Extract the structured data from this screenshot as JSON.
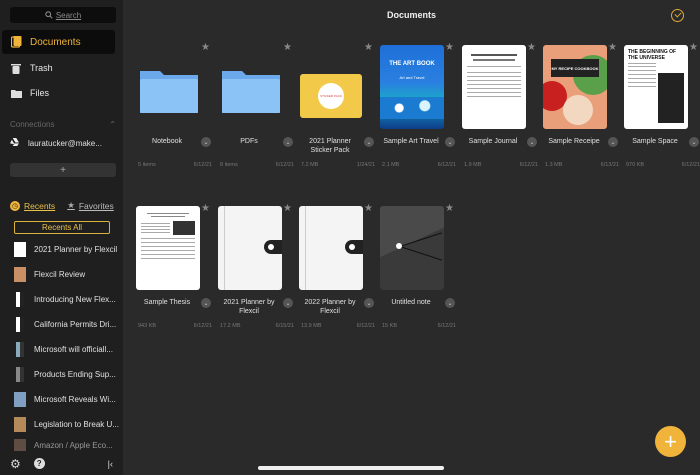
{
  "sidebar": {
    "search_placeholder": "Search",
    "nav": [
      {
        "label": "Documents",
        "icon": "documents-icon"
      },
      {
        "label": "Trash",
        "icon": "trash-icon"
      },
      {
        "label": "Files",
        "icon": "folder-icon"
      }
    ],
    "connections_label": "Connections",
    "account": "lauratucker@make...",
    "add_label": "+",
    "tabs": {
      "recents": "Recents",
      "favorites": "Favorites"
    },
    "recents_all": "Recents All",
    "recents": [
      {
        "title": "2021 Planner by Flexcil"
      },
      {
        "title": "Flexcil Review"
      },
      {
        "title": "Introducing New Flex..."
      },
      {
        "title": "California Permits Dri..."
      },
      {
        "title": "Microsoft will officiall..."
      },
      {
        "title": "Products Ending Sup..."
      },
      {
        "title": "Microsoft Reveals Wi..."
      },
      {
        "title": "Legislation to Break U..."
      },
      {
        "title": "Amazon / Apple Eco..."
      }
    ]
  },
  "header": {
    "title": "Documents"
  },
  "items": [
    {
      "name": "Notebook",
      "size": "5 items",
      "date": "6/12/21",
      "kind": "folder"
    },
    {
      "name": "PDFs",
      "size": "8 items",
      "date": "6/12/21",
      "kind": "folder"
    },
    {
      "name": "2021 Planner Sticker Pack",
      "size": "7.2 MB",
      "date": "1/24/21",
      "kind": "sticker",
      "inner_text": "STICKER PACK"
    },
    {
      "name": "Sample Art Travel",
      "size": "2.1 MB",
      "date": "6/12/21",
      "kind": "art",
      "inner_title": "THE ART BOOK",
      "inner_sub": "Art and Travel"
    },
    {
      "name": "Sample Journal",
      "size": "1.9 MB",
      "date": "6/12/21",
      "kind": "journal"
    },
    {
      "name": "Sample Receipe",
      "size": "1.3 MB",
      "date": "6/13/21",
      "kind": "recipe",
      "inner_title": "MY RECIPE COOKBOOK"
    },
    {
      "name": "Sample Space",
      "size": "970 KB",
      "date": "6/12/21",
      "kind": "space",
      "inner_title": "THE BEGINNING OF THE UNIVERSE"
    },
    {
      "name": "Sample Thesis",
      "size": "943 KB",
      "date": "6/12/21",
      "kind": "thesis"
    },
    {
      "name": "2021 Planner by Flexcil",
      "size": "17.2 MB",
      "date": "6/15/21",
      "kind": "planner-white"
    },
    {
      "name": "2022 Planner by Flexcil",
      "size": "13.9 MB",
      "date": "6/12/21",
      "kind": "planner-white"
    },
    {
      "name": "Untitled note",
      "size": "15 KB",
      "date": "6/12/21",
      "kind": "note-dark"
    }
  ],
  "colors": {
    "accent": "#f0b43a",
    "folder": "#7ab6f3"
  }
}
